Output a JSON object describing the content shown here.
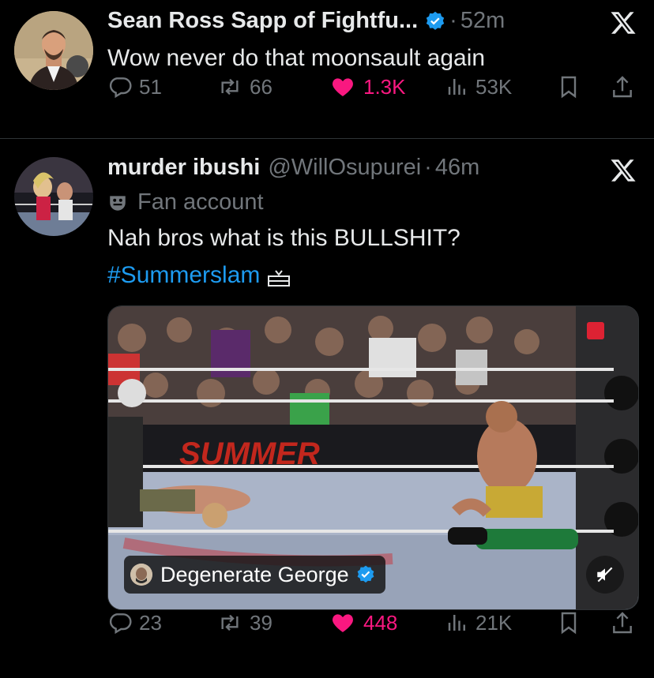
{
  "tweets": [
    {
      "author_name": "Sean Ross Sapp of Fightfu...",
      "time": "52m",
      "text": "Wow never do that moonsault again",
      "stats": {
        "replies": "51",
        "reposts": "66",
        "likes": "1.3K",
        "views": "53K"
      }
    },
    {
      "author_name": "murder ibushi",
      "handle": "@WillOsupurei",
      "time": "46m",
      "label": "Fan account",
      "text": "Nah bros what is this BULLSHIT?",
      "hashtag": "#Summerslam",
      "media": {
        "video_credit": "Degenerate George",
        "mute_icon": "speaker-muted-icon"
      },
      "stats": {
        "replies": "23",
        "reposts": "39",
        "likes": "448",
        "views": "21K"
      }
    }
  ],
  "colors": {
    "background": "#000000",
    "text_primary": "#e7e9ea",
    "text_secondary": "#71767b",
    "accent_blue": "#1d9bf0",
    "like_pink": "#f91880",
    "divider": "#2f3336"
  },
  "dot": "·"
}
